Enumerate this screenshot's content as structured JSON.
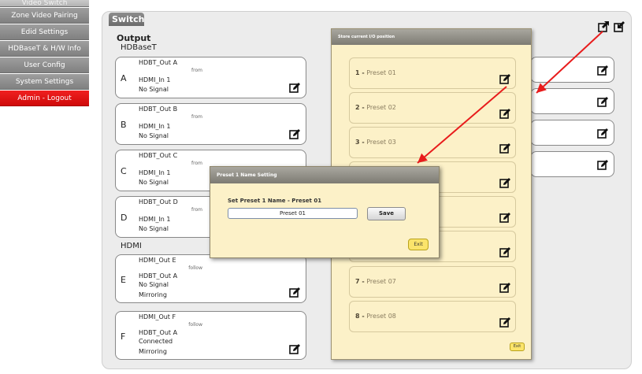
{
  "sidebar": {
    "items": [
      {
        "label": "Video Switch"
      },
      {
        "label": "Zone Video Pairing"
      },
      {
        "label": "Edid Settings"
      },
      {
        "label": "HDBaseT & H/W Info"
      },
      {
        "label": "User Config"
      },
      {
        "label": "System Settings"
      },
      {
        "label": "Admin - Logout"
      }
    ]
  },
  "main": {
    "tab": "Switch",
    "output_title": "Output",
    "groups": {
      "hdbaset": "HDBaseT",
      "hdmi": "HDMI"
    },
    "outputs": [
      {
        "name": "HDBT_Out A",
        "relation": "from",
        "letter": "A",
        "source": "HDMI_In 1",
        "status": "No Signal"
      },
      {
        "name": "HDBT_Out B",
        "relation": "from",
        "letter": "B",
        "source": "HDMI_In 1",
        "status": "No Signal"
      },
      {
        "name": "HDBT_Out C",
        "relation": "from",
        "letter": "C",
        "source": "HDMI_In 1",
        "status": "No Signal"
      },
      {
        "name": "HDBT_Out D",
        "relation": "from",
        "letter": "D",
        "source": "HDMI_In 1",
        "status": "No Signal"
      },
      {
        "name": "HDMI_Out E",
        "relation": "follow",
        "letter": "E",
        "source": "HDBT_Out A",
        "status": "No Signal",
        "mode": "Mirroring"
      },
      {
        "name": "HDMI_Out F",
        "relation": "follow",
        "letter": "F",
        "source": "HDBT_Out A",
        "status": "Connected",
        "mode": "Mirroring"
      }
    ]
  },
  "preset_modal": {
    "title": "Store current I/O position",
    "presets": [
      {
        "num": "1 -",
        "name": "Preset 01"
      },
      {
        "num": "2 -",
        "name": "Preset 02"
      },
      {
        "num": "3 -",
        "name": "Preset 03"
      },
      {
        "num": "",
        "name": ""
      },
      {
        "num": "",
        "name": ""
      },
      {
        "num": "",
        "name": ""
      },
      {
        "num": "7 -",
        "name": "Preset 07"
      },
      {
        "num": "8 -",
        "name": "Preset 08"
      }
    ],
    "exit_label": "Exit"
  },
  "name_modal": {
    "title": "Preset 1 Name Setting",
    "prompt": "Set Preset 1 Name - Preset 01",
    "input_value": "Preset 01",
    "save_label": "Save",
    "exit_label": "Exit"
  },
  "icons": {
    "edit": "edit-pencil-icon",
    "store": "store-preset-icon",
    "load": "load-preset-icon"
  },
  "colors": {
    "logout": "#e01212",
    "annotation_arrow": "#e81c1c",
    "modal_bg": "#fcf1c8",
    "exit_button": "#fbe46b"
  }
}
